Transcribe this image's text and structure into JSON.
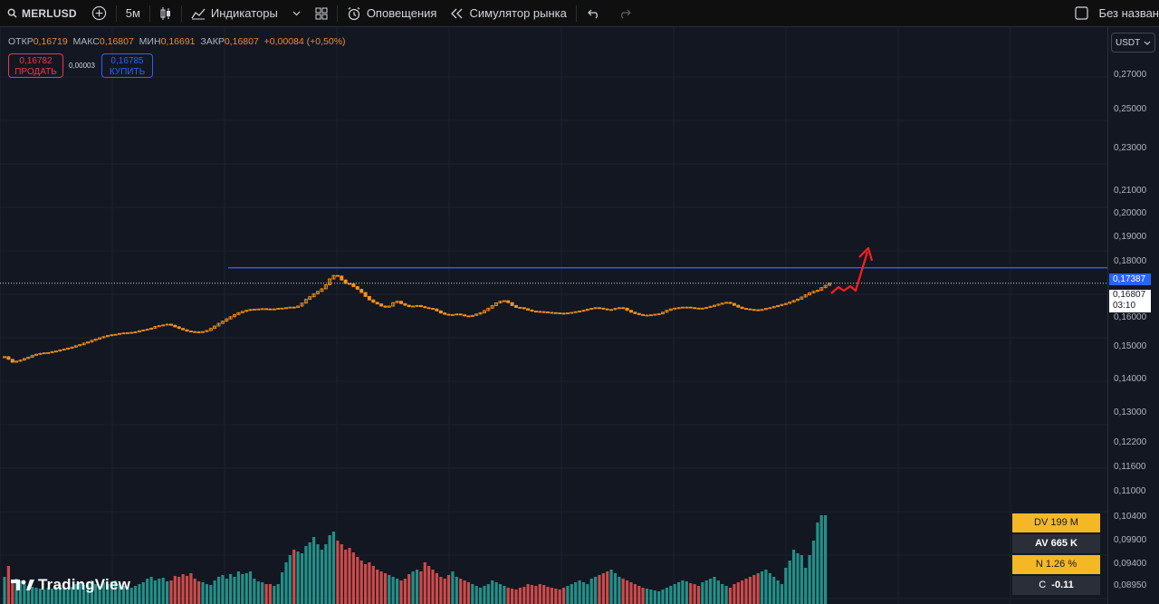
{
  "toolbar": {
    "symbol": "MERLUSD",
    "interval": "5м",
    "indicators_label": "Индикаторы",
    "alerts_label": "Оповещения",
    "replay_label": "Симулятор рынка",
    "layout_name": "Без назван"
  },
  "legend": {
    "open_label": "ОТКР",
    "open_value": "0,16719",
    "high_label": "МАКС",
    "high_value": "0,16807",
    "low_label": "МИН",
    "low_value": "0,16691",
    "close_label": "ЗАКР",
    "close_value": "0,16807",
    "change": "+0,00084 (+0,50%)"
  },
  "trade": {
    "sell_price": "0,16782",
    "sell_label": "ПРОДАТЬ",
    "spread": "0,00003",
    "buy_price": "0,16785",
    "buy_label": "КУПИТЬ"
  },
  "price_axis": {
    "currency": "USDT",
    "ticks": [
      "0,27000",
      "0,25000",
      "0,23000",
      "0,21000",
      "0,20000",
      "0,19000",
      "0,18000",
      "0,16000",
      "0,15000",
      "0,14000",
      "0,13000",
      "0,12200",
      "0,11600",
      "0,11000",
      "0,10400",
      "0,09900",
      "0,09400",
      "0,08950"
    ],
    "line_label": "0,17387",
    "last_price": "0,16807",
    "countdown": "03:10"
  },
  "stats": {
    "dv": "DV 199 M",
    "av": "AV 665 K",
    "n": "N 1.26 %",
    "c_label": "C",
    "c_value": "-0.11"
  },
  "branding": {
    "logo_text": "TradingView"
  },
  "colors": {
    "up": "#f7931a",
    "down": "#f7931a",
    "vol_up": "#26a69a",
    "vol_down": "#ef5350",
    "line": "#2962ff",
    "arrow": "#ff1e1e"
  },
  "chart_data": {
    "type": "candlestick",
    "price_line": 0.17387,
    "last_price": 0.16807,
    "closes": [
      0.1405,
      0.1395,
      0.1384,
      0.1388,
      0.1392,
      0.1398,
      0.1403,
      0.141,
      0.1414,
      0.1417,
      0.1419,
      0.142,
      0.1424,
      0.1426,
      0.143,
      0.1433,
      0.1437,
      0.1441,
      0.1446,
      0.145,
      0.1456,
      0.146,
      0.1466,
      0.1471,
      0.1476,
      0.148,
      0.1484,
      0.1487,
      0.1489,
      0.1492,
      0.1494,
      0.1495,
      0.1496,
      0.1498,
      0.1502,
      0.1505,
      0.1508,
      0.1512,
      0.1518,
      0.1521,
      0.1524,
      0.1527,
      0.1523,
      0.1517,
      0.1511,
      0.1506,
      0.1501,
      0.1499,
      0.1498,
      0.1497,
      0.1499,
      0.1503,
      0.1511,
      0.152,
      0.153,
      0.1538,
      0.1547,
      0.1555,
      0.1563,
      0.157,
      0.1575,
      0.1579,
      0.1582,
      0.1583,
      0.1584,
      0.1585,
      0.1584,
      0.1583,
      0.1584,
      0.1586,
      0.1587,
      0.1589,
      0.1591,
      0.159,
      0.1595,
      0.1606,
      0.162,
      0.163,
      0.1641,
      0.165,
      0.166,
      0.1675,
      0.1697,
      0.171,
      0.1708,
      0.1693,
      0.168,
      0.1679,
      0.1668,
      0.1658,
      0.1646,
      0.1631,
      0.1618,
      0.1609,
      0.1603,
      0.1595,
      0.1591,
      0.1595,
      0.1608,
      0.1613,
      0.1604,
      0.1598,
      0.1593,
      0.1595,
      0.1597,
      0.1593,
      0.1589,
      0.1586,
      0.1584,
      0.1577,
      0.1569,
      0.1564,
      0.1562,
      0.1563,
      0.1565,
      0.1562,
      0.1558,
      0.1556,
      0.156,
      0.1565,
      0.157,
      0.1578,
      0.1587,
      0.1597,
      0.1607,
      0.1613,
      0.1615,
      0.1608,
      0.1597,
      0.159,
      0.1589,
      0.1585,
      0.158,
      0.1576,
      0.1575,
      0.1574,
      0.1573,
      0.1571,
      0.157,
      0.1569,
      0.1568,
      0.1567,
      0.1569,
      0.1571,
      0.1574,
      0.1576,
      0.1579,
      0.1583,
      0.1586,
      0.1589,
      0.1587,
      0.1584,
      0.1581,
      0.1582,
      0.1586,
      0.1589,
      0.1587,
      0.1579,
      0.1572,
      0.1567,
      0.1563,
      0.1561,
      0.1561,
      0.1562,
      0.1564,
      0.1566,
      0.1572,
      0.1579,
      0.1584,
      0.1587,
      0.1589,
      0.1591,
      0.1591,
      0.1589,
      0.1587,
      0.1586,
      0.1587,
      0.159,
      0.1594,
      0.1598,
      0.1602,
      0.1606,
      0.1609,
      0.1605,
      0.1598,
      0.1591,
      0.1586,
      0.1584,
      0.1582,
      0.1581,
      0.158,
      0.1582,
      0.1586,
      0.1589,
      0.1593,
      0.1597,
      0.1601,
      0.1605,
      0.161,
      0.1616,
      0.1621,
      0.1629,
      0.1637,
      0.1645,
      0.165,
      0.1654,
      0.1664,
      0.1673,
      0.1681
    ],
    "volumes": [
      30,
      42,
      24,
      28,
      26,
      22,
      20,
      19,
      18,
      17,
      16,
      18,
      17,
      19,
      21,
      18,
      16,
      19,
      22,
      24,
      21,
      24,
      26,
      22,
      20,
      24,
      22,
      25,
      26,
      22,
      20,
      19,
      18,
      20,
      22,
      24,
      28,
      30,
      26,
      28,
      29,
      25,
      26,
      31,
      30,
      33,
      31,
      34,
      28,
      25,
      24,
      22,
      21,
      26,
      30,
      32,
      28,
      33,
      30,
      36,
      33,
      34,
      36,
      28,
      25,
      24,
      22,
      22,
      20,
      22,
      35,
      46,
      54,
      60,
      58,
      56,
      64,
      68,
      74,
      66,
      60,
      66,
      76,
      80,
      70,
      66,
      60,
      62,
      57,
      52,
      48,
      44,
      46,
      42,
      38,
      36,
      34,
      32,
      30,
      28,
      26,
      28,
      33,
      36,
      38,
      36,
      46,
      42,
      38,
      34,
      30,
      28,
      32,
      36,
      30,
      28,
      26,
      24,
      22,
      20,
      18,
      20,
      22,
      26,
      24,
      22,
      20,
      18,
      17,
      16,
      18,
      19,
      22,
      21,
      20,
      22,
      21,
      19,
      18,
      17,
      16,
      18,
      20,
      22,
      24,
      26,
      24,
      22,
      28,
      30,
      32,
      34,
      36,
      38,
      34,
      30,
      28,
      26,
      24,
      22,
      20,
      18,
      17,
      16,
      15,
      14,
      16,
      18,
      20,
      22,
      24,
      26,
      25,
      23,
      22,
      20,
      24,
      26,
      28,
      30,
      26,
      22,
      20,
      18,
      22,
      24,
      26,
      28,
      30,
      32,
      34,
      36,
      38,
      34,
      30,
      26,
      22,
      40,
      48,
      60,
      56,
      54,
      40,
      54,
      70,
      90,
      98,
      98
    ]
  }
}
